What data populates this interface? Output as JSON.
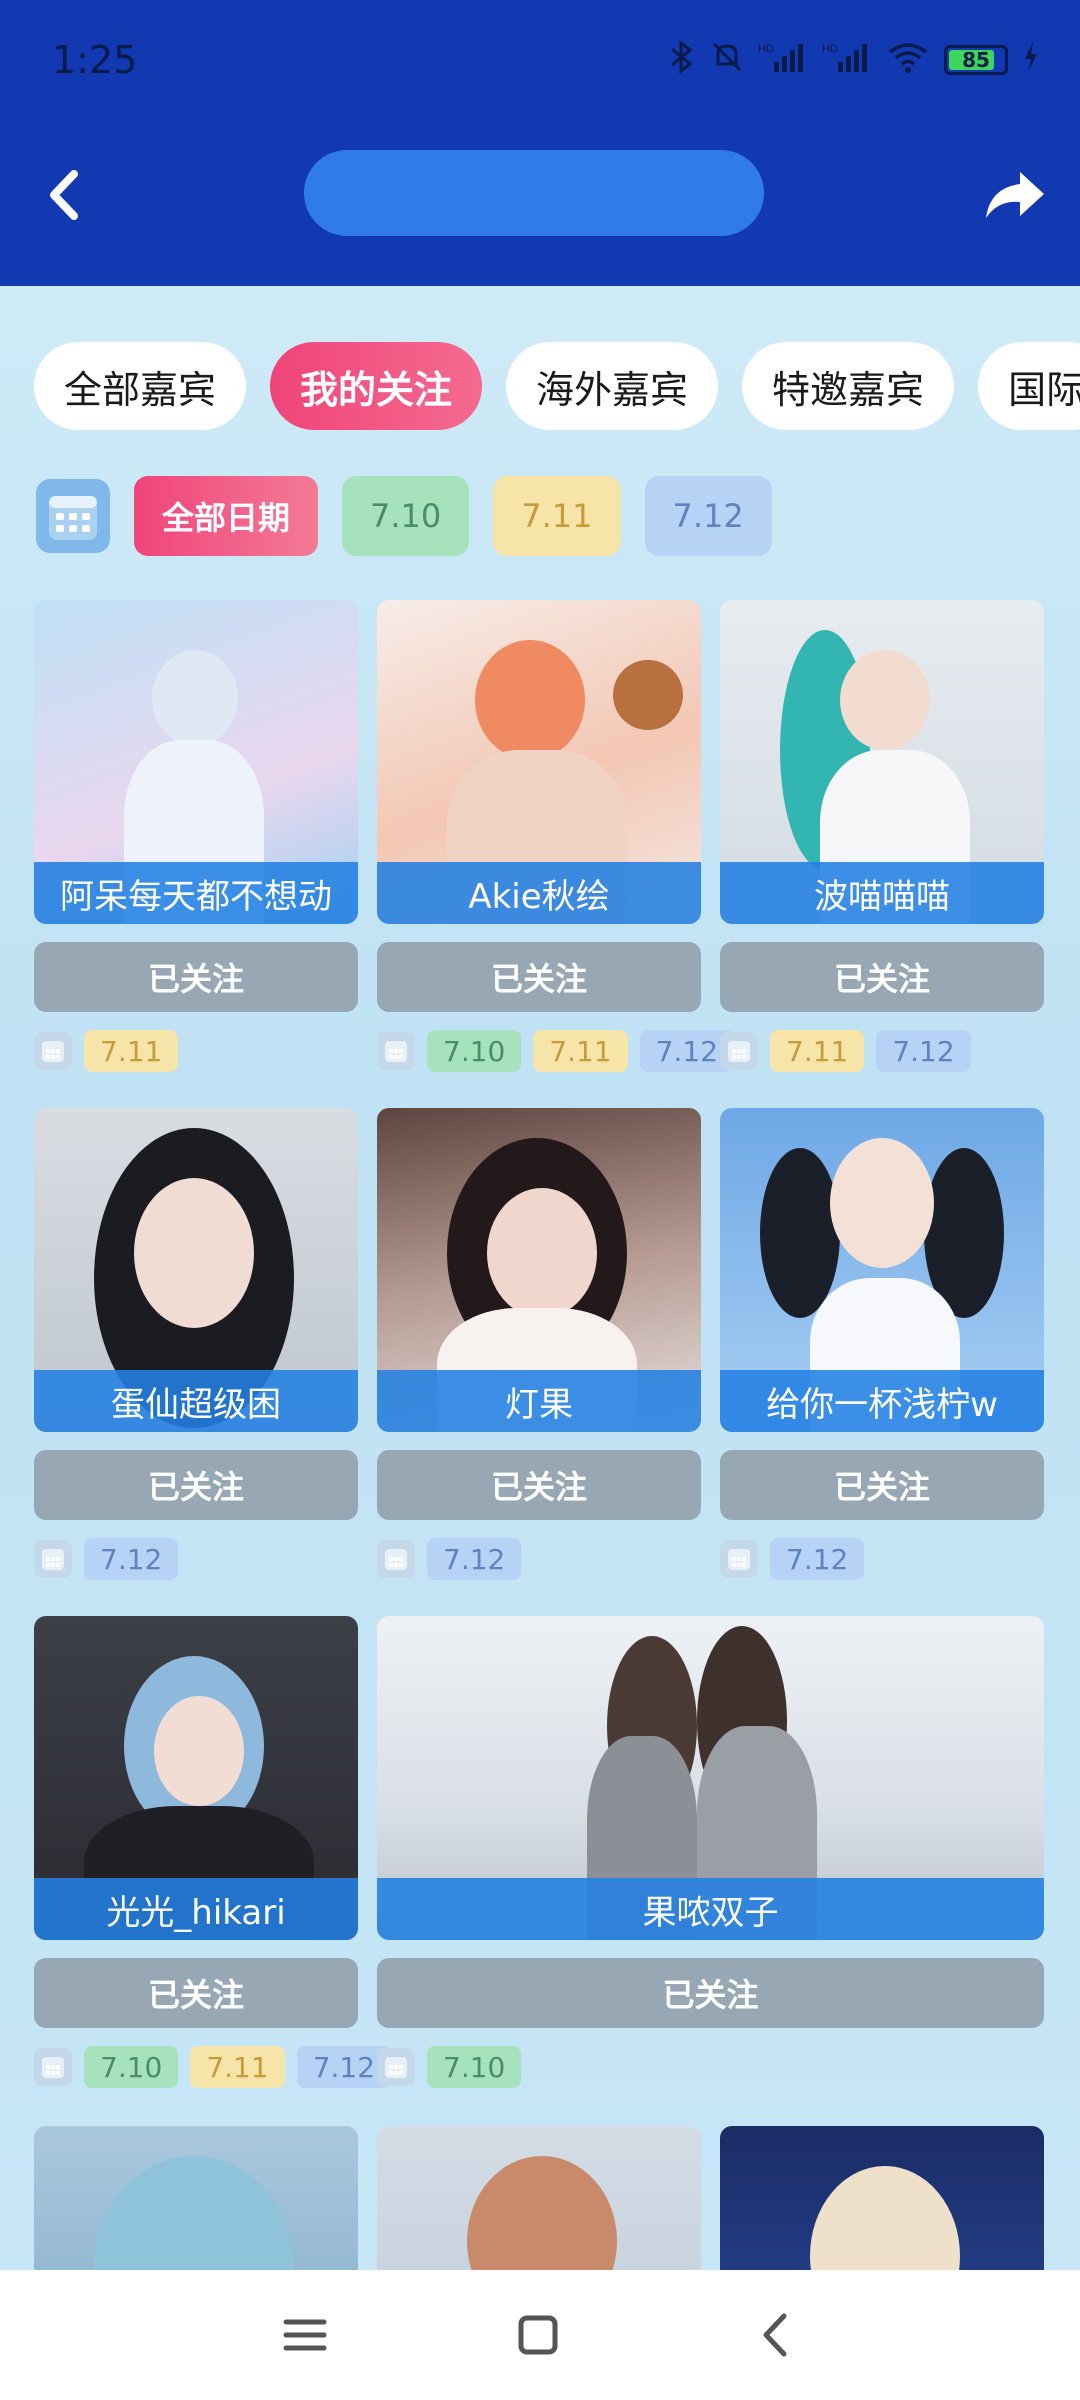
{
  "status": {
    "time": "1:25",
    "battery_level": 85,
    "battery_text": "85",
    "icons": [
      "bluetooth-icon",
      "mute-icon",
      "signal-hd-icon",
      "signal-hd-icon",
      "wifi-icon",
      "battery-icon",
      "charging-icon"
    ]
  },
  "header": {
    "back_icon": "chevron-left-icon",
    "share_icon": "share-arrow-icon",
    "accent": "#1339b2"
  },
  "tabs": [
    {
      "label": "全部嘉宾",
      "active": false
    },
    {
      "label": "我的关注",
      "active": true
    },
    {
      "label": "海外嘉宾",
      "active": false
    },
    {
      "label": "特邀嘉宾",
      "active": false
    },
    {
      "label": "国际",
      "active": false
    }
  ],
  "dates": {
    "all_label": "全部日期",
    "chips": [
      "7.10",
      "7.11",
      "7.12"
    ]
  },
  "follow_label": "已关注",
  "guests": [
    {
      "name": "阿呆每天都不想动",
      "dates": [
        "7.11"
      ]
    },
    {
      "name": "Akie秋绘",
      "dates": [
        "7.10",
        "7.11",
        "7.12"
      ]
    },
    {
      "name": "波喵喵喵",
      "dates": [
        "7.11",
        "7.12"
      ]
    },
    {
      "name": "蛋仙超级困",
      "dates": [
        "7.12"
      ]
    },
    {
      "name": "灯果",
      "dates": [
        "7.12"
      ]
    },
    {
      "name": "给你一杯浅柠w",
      "dates": [
        "7.12"
      ]
    },
    {
      "name": "光光_hikari",
      "dates": [
        "7.10",
        "7.11",
        "7.12"
      ]
    },
    {
      "name": "果哝双子",
      "dates": [
        "7.10"
      ]
    }
  ],
  "colors": {
    "date_7_10": "#a6e3bd",
    "date_7_11": "#f6e4a8",
    "date_7_12": "#b6d3f6",
    "active_pink": "#f0447a",
    "follow_gray": "#97a8b4"
  }
}
